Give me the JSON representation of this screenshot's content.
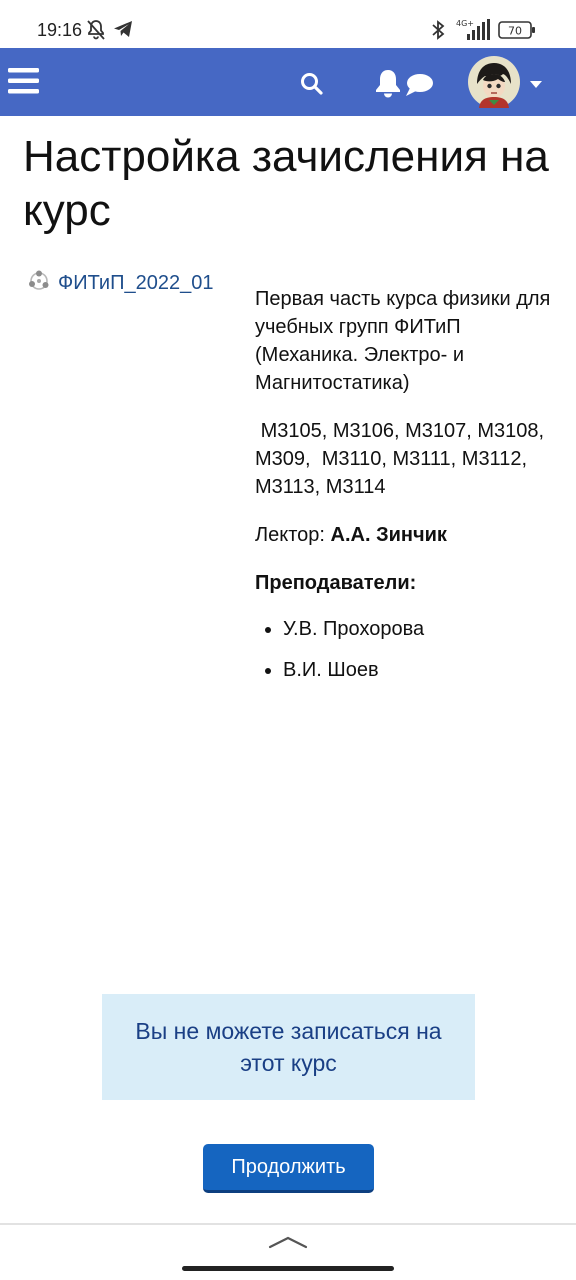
{
  "status_bar": {
    "time": "19:16",
    "battery": "70",
    "icons": [
      "bell-off-icon",
      "telegram-icon",
      "bluetooth-icon",
      "signal-icon",
      "battery-icon"
    ]
  },
  "navbar": {
    "color": "#4668c4",
    "icons": [
      "menu-icon",
      "search-icon",
      "notifications-icon",
      "messages-icon",
      "avatar",
      "chevron-down-icon"
    ]
  },
  "page": {
    "title": "Настройка зачисления на курс",
    "course_link": "ФИТиП_2022_01"
  },
  "summary": {
    "intro": "Первая часть курса физики для учебных групп ФИТиП (Механика. Электро- и Магнитостатика)",
    "groups": " M3105, M3106, M3107, M3108, M309,  M3110, M3111, M3112, M3113, M3114",
    "lecturer_label": "Лектор: ",
    "lecturer_name": "А.А. Зинчик",
    "teachers_heading": "Преподаватели:",
    "teachers": [
      "У.В. Прохорова",
      "В.И. Шоев"
    ]
  },
  "notice": {
    "text": "Вы не можете записаться на этот курс"
  },
  "continue_button": {
    "label": "Продолжить"
  }
}
